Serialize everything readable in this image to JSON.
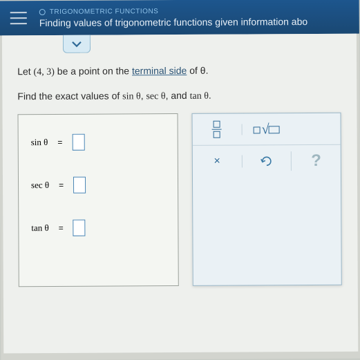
{
  "header": {
    "overline": "TRIGONOMETRIC FUNCTIONS",
    "title": "Finding values of trigonometric functions given information abo"
  },
  "problem": {
    "line1_a": "Let ",
    "point": "(4, 3)",
    "line1_b": " be a point on the ",
    "link": "terminal side",
    "line1_c": " of θ.",
    "line2_a": "Find the exact values of ",
    "f1": "sin θ",
    "sep1": ", ",
    "f2": "sec θ",
    "sep2": ", and ",
    "f3": "tan θ",
    "line2_b": "."
  },
  "answers": {
    "r1": "sin θ",
    "r2": "sec θ",
    "r3": "tan θ",
    "eq": "="
  },
  "palette": {
    "times": "×",
    "help": "?"
  }
}
